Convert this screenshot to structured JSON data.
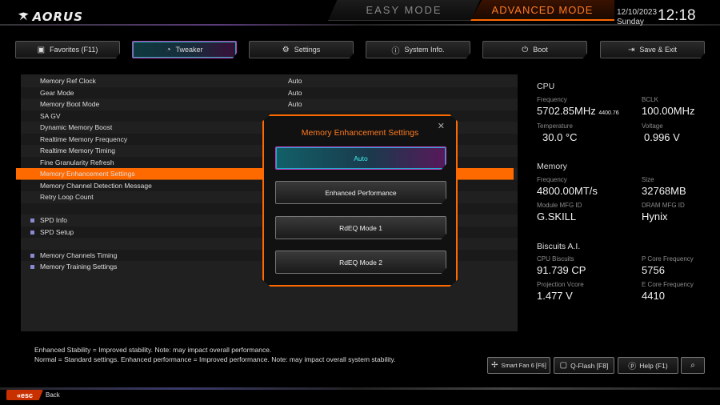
{
  "header": {
    "logo": "AORUS",
    "easy_mode": "EASY MODE",
    "advanced_mode": "ADVANCED MODE",
    "date": "12/10/2023",
    "day": "Sunday",
    "time": "12:18"
  },
  "tabs": [
    {
      "label": "Favorites (F11)",
      "icon": "favorites-icon"
    },
    {
      "label": "Tweaker",
      "icon": "speedometer-icon",
      "active": true
    },
    {
      "label": "Settings",
      "icon": "gear-icon"
    },
    {
      "label": "System Info.",
      "icon": "info-icon"
    },
    {
      "label": "Boot",
      "icon": "power-icon"
    },
    {
      "label": "Save & Exit",
      "icon": "exit-icon"
    }
  ],
  "settings": [
    {
      "label": "Memory Ref Clock",
      "value": "Auto"
    },
    {
      "label": "Gear Mode",
      "value": "Auto"
    },
    {
      "label": "Memory Boot Mode",
      "value": "Auto"
    },
    {
      "label": "SA GV",
      "value": ""
    },
    {
      "label": "Dynamic Memory Boost",
      "value": ""
    },
    {
      "label": "Realtime Memory Frequency",
      "value": ""
    },
    {
      "label": "Realtime Memory Timing",
      "value": ""
    },
    {
      "label": "Fine Granularity Refresh",
      "value": ""
    },
    {
      "label": "Memory Enhancement Settings",
      "value": ""
    },
    {
      "label": "Memory Channel Detection Message",
      "value": ""
    },
    {
      "label": "Retry Loop Count",
      "value": ""
    },
    {
      "label": "",
      "value": ""
    },
    {
      "label": "SPD Info",
      "value": ""
    },
    {
      "label": "SPD Setup",
      "value": ""
    },
    {
      "label": "",
      "value": ""
    },
    {
      "label": "Memory Channels Timing",
      "value": ""
    },
    {
      "label": "Memory Training Settings",
      "value": ""
    }
  ],
  "notes": {
    "line1": "Enhanced Stability = Improved stability. Note: may impact overall performance.",
    "line2": "Normal = Standard settings. Enhanced performance = Improved performance. Note: may impact overall system stability."
  },
  "footer": {
    "esc": "«esc",
    "back": "Back",
    "smart_fan": "Smart Fan 6 [F6]",
    "qflash": "Q-Flash [F8]",
    "help": "Help (F1)"
  },
  "info": {
    "cpu": {
      "title": "CPU",
      "frequency_label": "Frequency",
      "frequency": "5702.85MHz",
      "frequency_sub": "4400.76",
      "bclk_label": "BCLK",
      "bclk": "100.00MHz",
      "temp_label": "Temperature",
      "temp": "30.0 °C",
      "voltage_label": "Voltage",
      "voltage": "0.996 V"
    },
    "memory": {
      "title": "Memory",
      "frequency_label": "Frequency",
      "frequency": "4800.00MT/s",
      "size_label": "Size",
      "size": "32768MB",
      "module_label": "Module MFG ID",
      "module": "G.SKILL",
      "dram_label": "DRAM MFG ID",
      "dram": "Hynix"
    },
    "biscuits": {
      "title": "Biscuits A.I.",
      "cpu_label": "CPU Biscuits",
      "cpu": "91.739 CP",
      "pcore_label": "P Core Frequency",
      "pcore": "5756",
      "vcore_label": "Projection Vcore",
      "vcore": "1.477 V",
      "ecore_label": "E Core Frequency",
      "ecore": "4410"
    }
  },
  "modal": {
    "title": "Memory Enhancement Settings",
    "options": [
      "Auto",
      "Enhanced Performance",
      "RdEQ Mode 1",
      "RdEQ Mode 2"
    ],
    "selected": "Auto"
  },
  "colors": {
    "accent": "#ff6a00",
    "active_tab": "#1a8a90",
    "bg": "#000000"
  }
}
